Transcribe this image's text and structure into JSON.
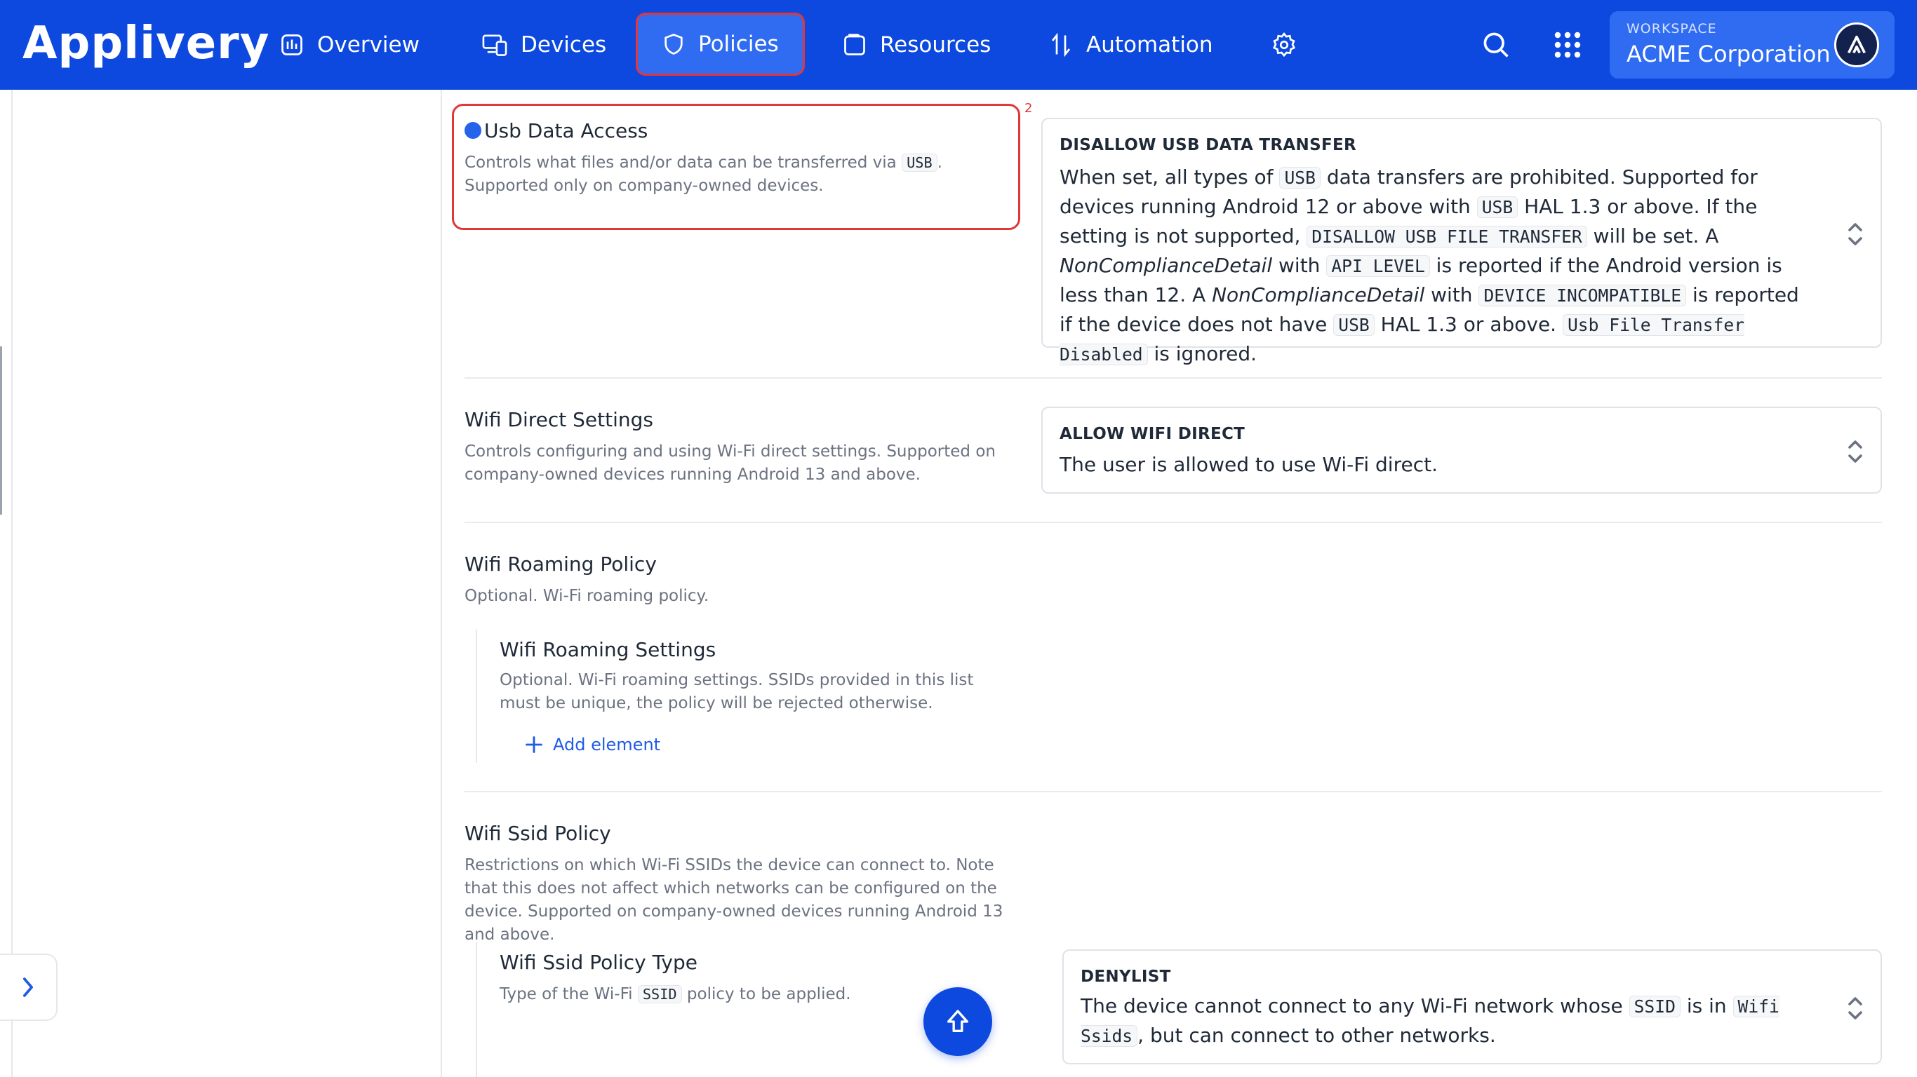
{
  "brand": {
    "name": "Applivery",
    "primary_color": "#0d49df",
    "accent_red": "#e0373b"
  },
  "nav": {
    "items": [
      {
        "label": "Overview",
        "icon": "chart-bars-icon"
      },
      {
        "label": "Devices",
        "icon": "devices-icon"
      },
      {
        "label": "Policies",
        "icon": "shield-icon",
        "active": true
      },
      {
        "label": "Resources",
        "icon": "resources-icon"
      },
      {
        "label": "Automation",
        "icon": "automation-icon"
      }
    ],
    "settings_icon": "gear-icon",
    "search_icon": "search-icon",
    "apps_icon": "grid-dots-icon"
  },
  "workspace": {
    "label": "WORKSPACE",
    "name": "ACME Corporation",
    "avatar_icon": "logo-a-icon"
  },
  "annotation": {
    "number": "2"
  },
  "sections": {
    "usb": {
      "title": "Usb Data Access",
      "desc_parts": [
        "Controls what files and/or data can be transferred via ",
        "USB",
        ". Supported only on company-owned devices."
      ],
      "select": {
        "label": "DISALLOW USB DATA TRANSFER",
        "text": [
          {
            "t": "When set, all types of "
          },
          {
            "c": "USB"
          },
          {
            "t": " data transfers are prohibited. Supported for devices running Android 12 or above with "
          },
          {
            "c": "USB"
          },
          {
            "t": " HAL 1.3 or above. If the setting is not supported, "
          },
          {
            "c": "DISALLOW USB FILE TRANSFER"
          },
          {
            "t": " will be set. A "
          },
          {
            "i": "NonComplianceDetail"
          },
          {
            "t": " with "
          },
          {
            "c": "API LEVEL"
          },
          {
            "t": " is reported if the Android version is less than 12. A "
          },
          {
            "i": "NonComplianceDetail"
          },
          {
            "t": " with "
          },
          {
            "c": "DEVICE INCOMPATIBLE"
          },
          {
            "t": " is reported if the device does not have "
          },
          {
            "c": "USB"
          },
          {
            "t": " HAL 1.3 or above. "
          },
          {
            "c": "Usb File Transfer Disabled"
          },
          {
            "t": " is ignored."
          }
        ]
      }
    },
    "wifi_direct": {
      "title": "Wifi Direct Settings",
      "desc": "Controls configuring and using Wi-Fi direct settings. Supported on company-owned devices running Android 13 and above.",
      "select": {
        "label": "ALLOW WIFI DIRECT",
        "text": "The user is allowed to use Wi-Fi direct."
      }
    },
    "wifi_roaming": {
      "title": "Wifi Roaming Policy",
      "desc": "Optional. Wi-Fi roaming policy.",
      "nested": {
        "title": "Wifi Roaming Settings",
        "desc": "Optional. Wi-Fi roaming settings. SSIDs provided in this list must be unique, the policy will be rejected otherwise.",
        "add_label": "Add element"
      }
    },
    "wifi_ssid": {
      "title": "Wifi Ssid Policy",
      "desc": "Restrictions on which Wi-Fi SSIDs the device can connect to. Note that this does not affect which networks can be configured on the device. Supported on company-owned devices running Android 13 and above.",
      "nested": {
        "title": "Wifi Ssid Policy Type",
        "desc_parts": [
          "Type of the Wi-Fi ",
          "SSID",
          " policy to be applied."
        ]
      },
      "select": {
        "label": "DENYLIST",
        "text": [
          {
            "t": "The device cannot connect to any Wi-Fi network whose "
          },
          {
            "c": "SSID"
          },
          {
            "t": " is in "
          },
          {
            "c": "Wifi Ssids"
          },
          {
            "t": ", but can connect to other networks."
          }
        ]
      }
    }
  },
  "fab_icon": "arrow-up-icon",
  "sidebar_toggle_icon": "chevron-right-icon"
}
